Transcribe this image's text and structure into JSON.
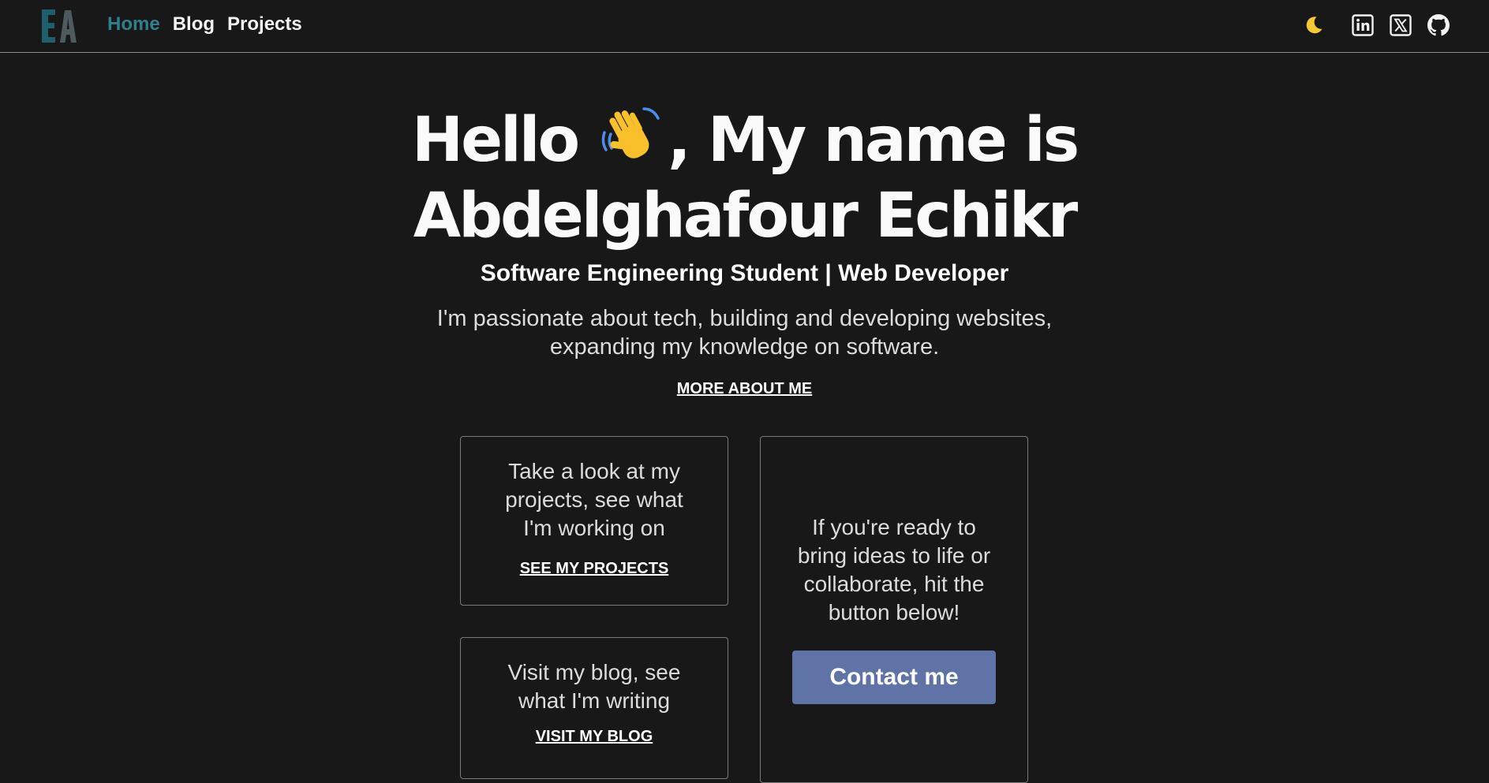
{
  "header": {
    "logo_text": "EA",
    "nav": [
      {
        "label": "Home",
        "active": true
      },
      {
        "label": "Blog",
        "active": false
      },
      {
        "label": "Projects",
        "active": false
      }
    ],
    "icons": [
      "moon-icon",
      "linkedin-icon",
      "x-twitter-icon",
      "github-icon"
    ]
  },
  "hero": {
    "title_line1_before": "Hello",
    "title_line1_after": ", My name is",
    "title_line2": "Abdelghafour Echikr",
    "wave_icon": "waving-hand-icon",
    "subtitle": "Software Engineering Student | Web Developer",
    "intro_line1": "I'm passionate about tech, building and developing websites,",
    "intro_line2": "expanding my knowledge on software.",
    "more_link": "MORE ABOUT ME"
  },
  "cards": {
    "projects": {
      "text": "Take a look at my projects, see what I'm working on",
      "link": "SEE MY PROJECTS"
    },
    "blog": {
      "text": "Visit my blog, see what I'm writing",
      "link": "VISIT MY BLOG"
    },
    "contact": {
      "text": "If you're ready to bring ideas to life or collaborate, hit the button below!",
      "button": "Contact me"
    }
  },
  "colors": {
    "background": "#181818",
    "accent_nav_active": "#2f7f8c",
    "contact_button": "#5f73a6",
    "moon": "#f5c83a",
    "wave": "#f8c02b"
  }
}
